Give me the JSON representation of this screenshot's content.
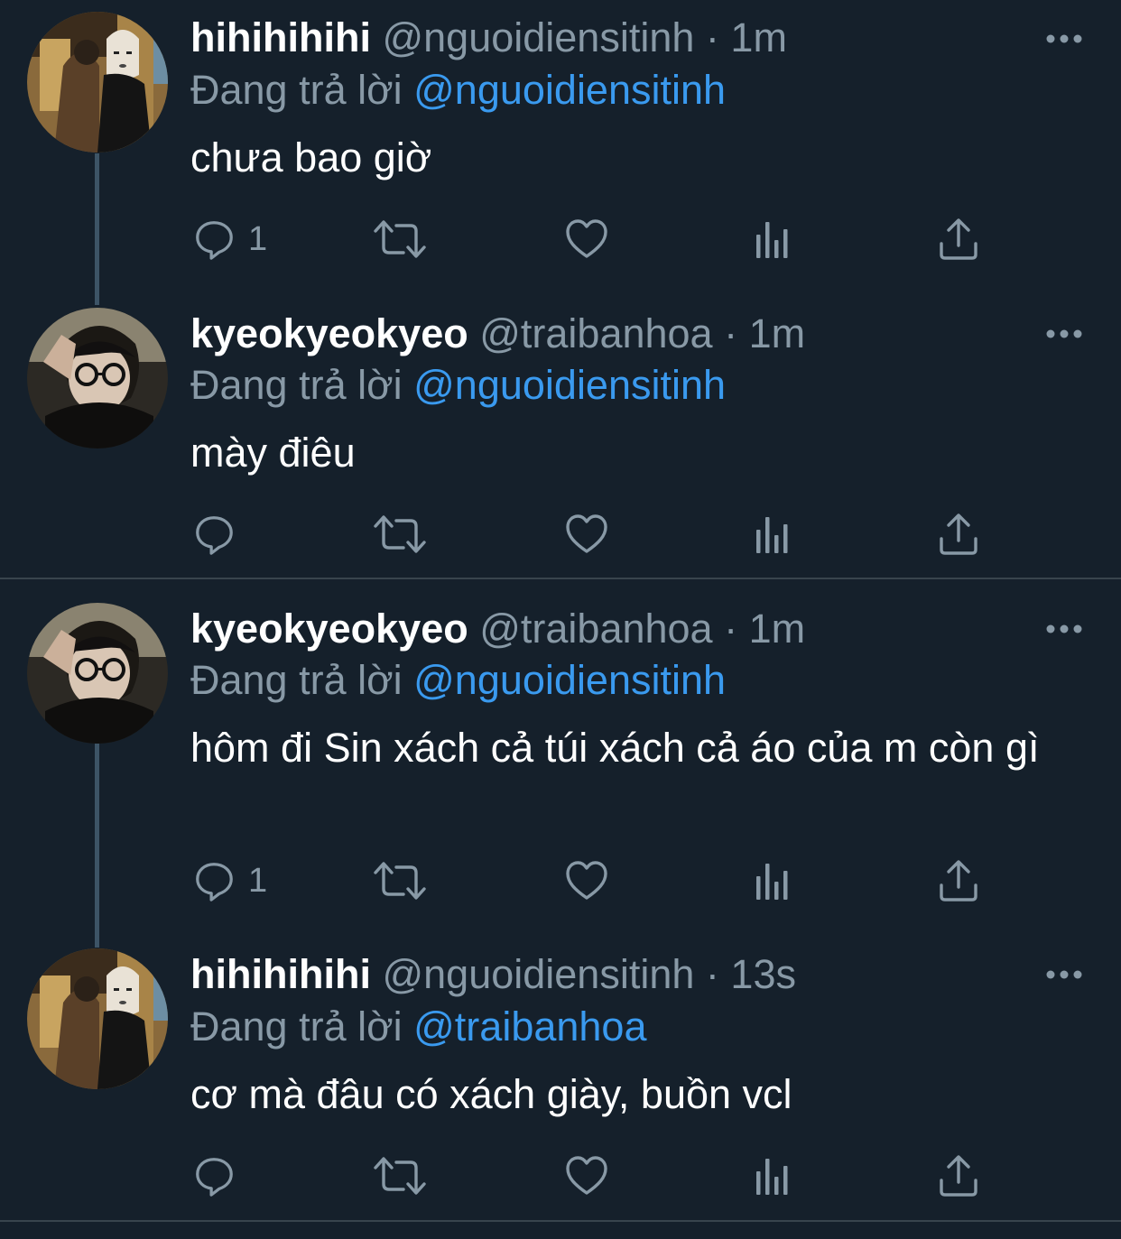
{
  "tweets": [
    {
      "name": "hihihihihi",
      "handle": "@nguoidiensitinh",
      "sep": "·",
      "time": "1m",
      "reply_prefix": "Đang trả lời",
      "reply_to": "@nguoidiensitinh",
      "text": "chưa bao giờ",
      "reply_count": "1",
      "avatar": "avatar-noface"
    },
    {
      "name": "kyeokyeokyeo",
      "handle": "@traibanhoa",
      "sep": "·",
      "time": "1m",
      "reply_prefix": "Đang trả lời",
      "reply_to": "@nguoidiensitinh",
      "text": "mày điêu",
      "reply_count": "",
      "avatar": "avatar-glasses"
    },
    {
      "name": "kyeokyeokyeo",
      "handle": "@traibanhoa",
      "sep": "·",
      "time": "1m",
      "reply_prefix": "Đang trả lời",
      "reply_to": "@nguoidiensitinh",
      "text": "hôm đi Sin xách cả túi xách cả áo của m còn gì",
      "reply_count": "1",
      "avatar": "avatar-glasses"
    },
    {
      "name": "hihihihihi",
      "handle": "@nguoidiensitinh",
      "sep": "·",
      "time": "13s",
      "reply_prefix": "Đang trả lời",
      "reply_to": "@traibanhoa",
      "text": "cơ mà đâu có xách giày, buồn vcl",
      "reply_count": "",
      "avatar": "avatar-noface"
    }
  ],
  "colors": {
    "background": "#15202b",
    "secondary_text": "#8899a6",
    "mention": "#3a9aef",
    "divider": "#38444d",
    "icon": "#8899a6"
  },
  "icons": [
    "reply-icon",
    "retweet-icon",
    "like-icon",
    "analytics-icon",
    "share-icon",
    "more-icon"
  ]
}
